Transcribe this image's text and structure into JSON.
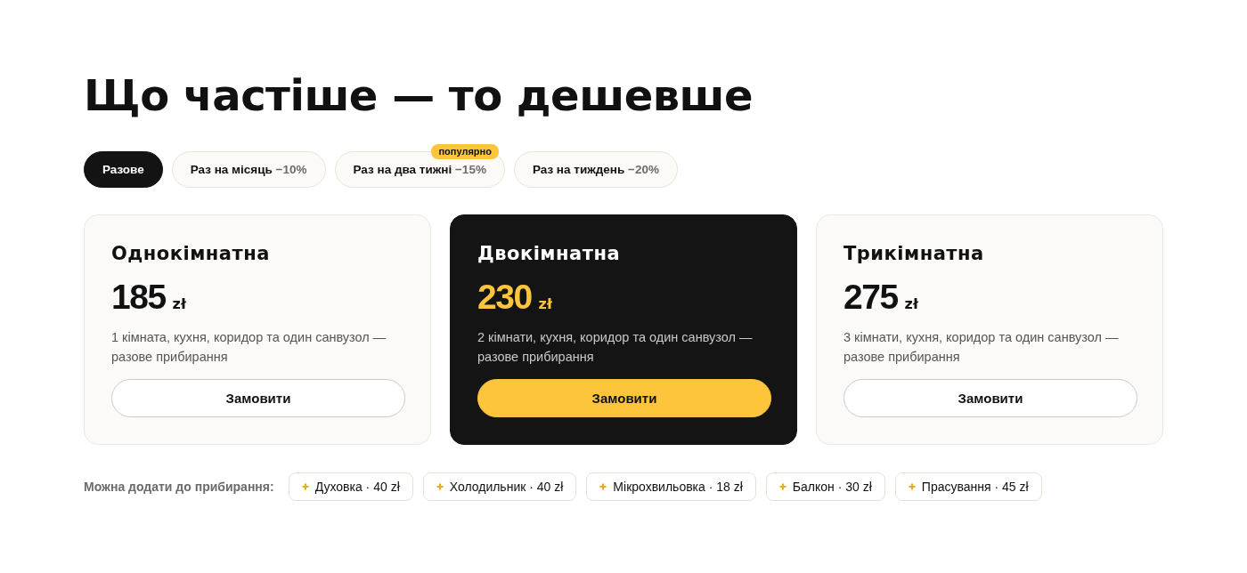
{
  "heading": "Що частіше — то дешевше",
  "tabs": [
    {
      "label": "Разове",
      "selected": true
    },
    {
      "label": "Раз на місяць",
      "discount": "−10%",
      "selected": false
    },
    {
      "label": "Раз на два тижні",
      "discount": "−15%",
      "badge": "популярно",
      "selected": false
    },
    {
      "label": "Раз на тиждень",
      "discount": "−20%",
      "selected": false
    }
  ],
  "plans": [
    {
      "title": "Однокімнатна",
      "price": "185",
      "currency": "zł",
      "description": "1 кімната, кухня, коридор та один санвузол — разове прибирання",
      "button": "Замовити",
      "featured": false
    },
    {
      "title": "Двокімнатна",
      "price": "230",
      "currency": "zł",
      "description": "2 кімнати, кухня, коридор та один санвузол — разове прибирання",
      "button": "Замовити",
      "featured": true
    },
    {
      "title": "Трикімнатна",
      "price": "275",
      "currency": "zł",
      "description": "3 кімнати, кухня, коридор та один санвузол — разове прибирання",
      "button": "Замовити",
      "featured": false
    }
  ],
  "addons": {
    "label": "Можна додати до прибирання:",
    "items": [
      {
        "name": "Духовка · 40 zł"
      },
      {
        "name": "Холодильник · 40 zł"
      },
      {
        "name": "Мікрохвильовка · 18 zł"
      },
      {
        "name": "Балкон · 30 zł"
      },
      {
        "name": "Прасування · 45 zł"
      }
    ]
  }
}
